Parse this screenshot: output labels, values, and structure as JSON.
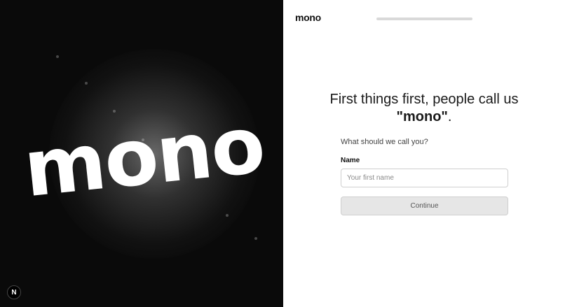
{
  "hero": {
    "word": "mono",
    "badge": "N"
  },
  "header": {
    "brand": "mono",
    "progress": 0
  },
  "form": {
    "heading_prefix": "First things first, people call us ",
    "heading_emphasis": "\"mono\"",
    "heading_suffix": ".",
    "subtext": "What should we call you?",
    "name_label": "Name",
    "name_placeholder": "Your first name",
    "name_value": "",
    "continue_label": "Continue"
  },
  "colors": {
    "hero_background": "#0a0a0a",
    "panel_background": "#ffffff",
    "button_background": "#e6e6e6",
    "progress_track": "#d9d9d9"
  }
}
